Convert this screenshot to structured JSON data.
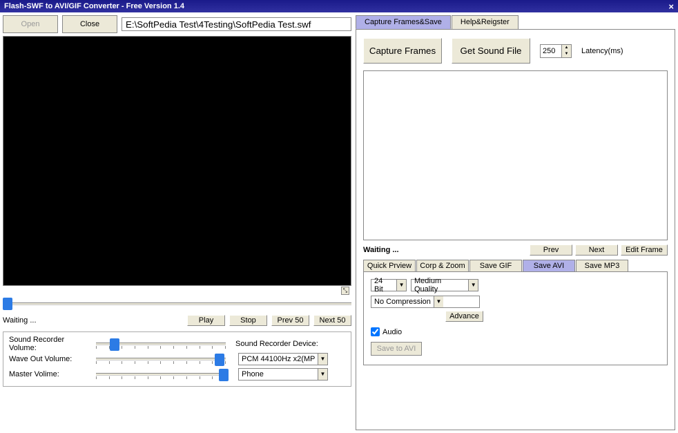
{
  "window": {
    "title": "Flash-SWF to AVI/GIF Converter - Free Version 1.4"
  },
  "top": {
    "open": "Open",
    "close": "Close",
    "filepath": "E:\\SoftPedia Test\\4Testing\\SoftPedia Test.swf"
  },
  "player": {
    "status": "Waiting ...",
    "play": "Play",
    "stop": "Stop",
    "prev50": "Prev 50",
    "next50": "Next 50"
  },
  "sound": {
    "rec_label": "Sound Recorder Volume:",
    "wave_label": "Wave Out Volume:",
    "master_label": "Master Volime:",
    "device_label": "Sound Recorder Device:",
    "device_value": "PCM 44100Hz x2(MP",
    "phone_value": "Phone"
  },
  "tabs": {
    "capture": "Capture Frames&Save",
    "help": "Help&Reigster"
  },
  "capture": {
    "capture_btn": "Capture Frames",
    "sound_btn": "Get Sound File",
    "latency": "250",
    "latency_label": "Latency(ms)",
    "waiting": "Waiting ...",
    "prev": "Prev",
    "next": "Next",
    "edit": "Edit Frame"
  },
  "subtabs": {
    "quick": "Quick Prview",
    "crop": "Corp & Zoom",
    "gif": "Save GIF",
    "avi": "Save AVI",
    "mp3": "Save MP3"
  },
  "avi": {
    "bit": "24 Bit",
    "quality": "Medium Quality",
    "compression": "No Compression",
    "advance": "Advance",
    "audio": "Audio",
    "save": "Save to AVI"
  }
}
